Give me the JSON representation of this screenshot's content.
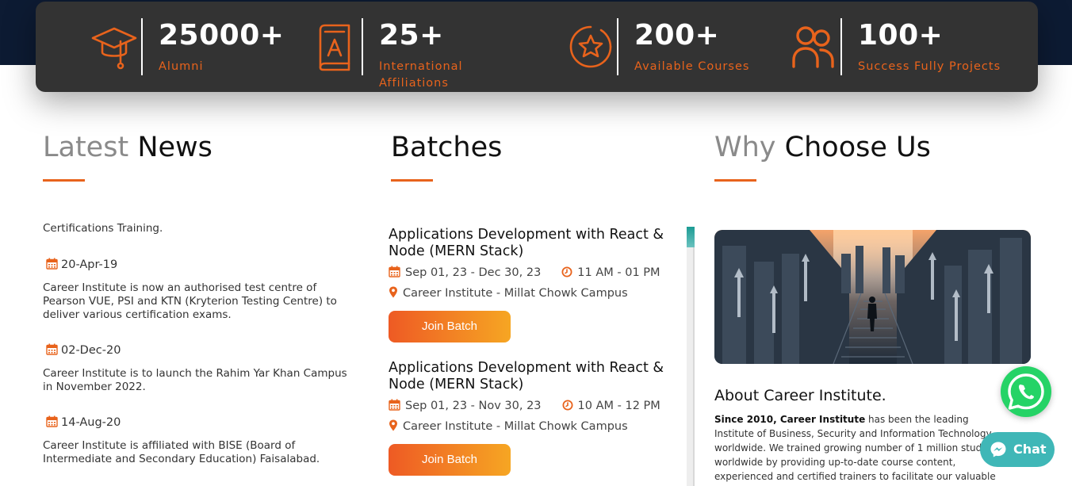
{
  "stats": [
    {
      "number": "25000+",
      "label_lines": [
        "Alumni"
      ],
      "icon": "graduation-cap-icon"
    },
    {
      "number": "25+",
      "label_lines": [
        "International",
        "Affiliations"
      ],
      "icon": "book-icon"
    },
    {
      "number": "200+",
      "label_lines": [
        "Available Courses"
      ],
      "icon": "star-badge-icon"
    },
    {
      "number": "100+",
      "label_lines": [
        "Success Fully Projects"
      ],
      "icon": "users-icon"
    }
  ],
  "latest_news": {
    "title_light": "Latest",
    "title_bold": "News",
    "intro": "Certifications Training.",
    "items": [
      {
        "date": "20-Apr-19",
        "text": "Career Institute is now an authorised test centre of Pearson VUE, PSI and KTN (Kryterion Testing Centre) to deliver various certification exams."
      },
      {
        "date": "02-Dec-20",
        "text": "Career Institute is to launch the Rahim Yar Khan Campus in November 2022."
      },
      {
        "date": "14-Aug-20",
        "text": "Career Institute is affiliated with BISE (Board of Intermediate and Secondary Education) Faisalabad."
      }
    ]
  },
  "batches": {
    "title": "Batches",
    "items": [
      {
        "name": "Applications Development with React & Node (MERN Stack)",
        "dates": "Sep 01, 23 - Dec 30, 23",
        "time": "11 AM - 01 PM",
        "location": "Career Institute - Millat Chowk Campus",
        "button": "Join Batch"
      },
      {
        "name": "Applications Development with React & Node (MERN Stack)",
        "dates": "Sep 01, 23 - Nov 30, 23",
        "time": "10 AM - 12 PM",
        "location": "Career Institute - Millat Chowk Campus",
        "button": "Join Batch"
      }
    ]
  },
  "why_choose": {
    "title_light": "Why",
    "title_bold": "Choose Us",
    "about_title": "About Career Institute.",
    "about_lead": "Since 2010, Career Institute",
    "about_body": " has been the leading Institute of Business, Security and Information Technology worldwide. We trained growing number of 1 million students worldwide by providing up-to-date course content, experienced and certified trainers to facilitate our valuable students in achieving"
  },
  "floating": {
    "chat_label": "Chat",
    "whatsapp_icon": "whatsapp-icon",
    "messenger_icon": "messenger-icon"
  },
  "colors": {
    "accent": "#e8631c",
    "stats_bg": "#333333",
    "header_bg": "#0d1b33",
    "chat_bg": "#3fb7b7",
    "whatsapp": "#25d366"
  }
}
